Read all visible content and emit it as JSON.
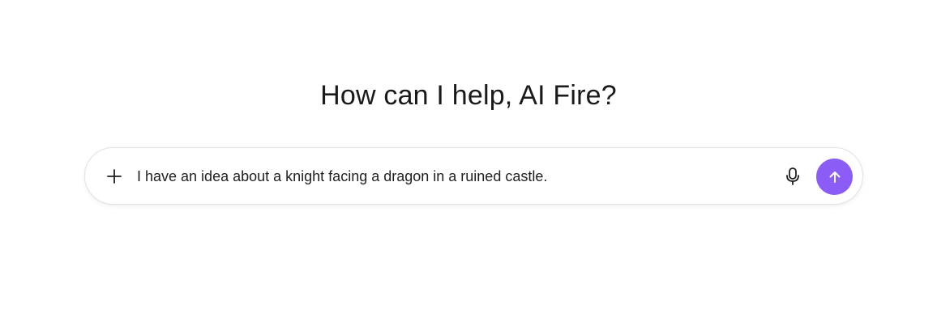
{
  "greeting": "How can I help, AI Fire?",
  "composer": {
    "value": "I have an idea about a knight facing a dragon in a ruined castle.",
    "icons": {
      "attach": "plus-icon",
      "voice": "microphone-icon",
      "send": "arrow-up-icon"
    }
  },
  "colors": {
    "accent": "#8b5cf6",
    "text": "#1f1f1f",
    "border": "#e3e3e3"
  }
}
